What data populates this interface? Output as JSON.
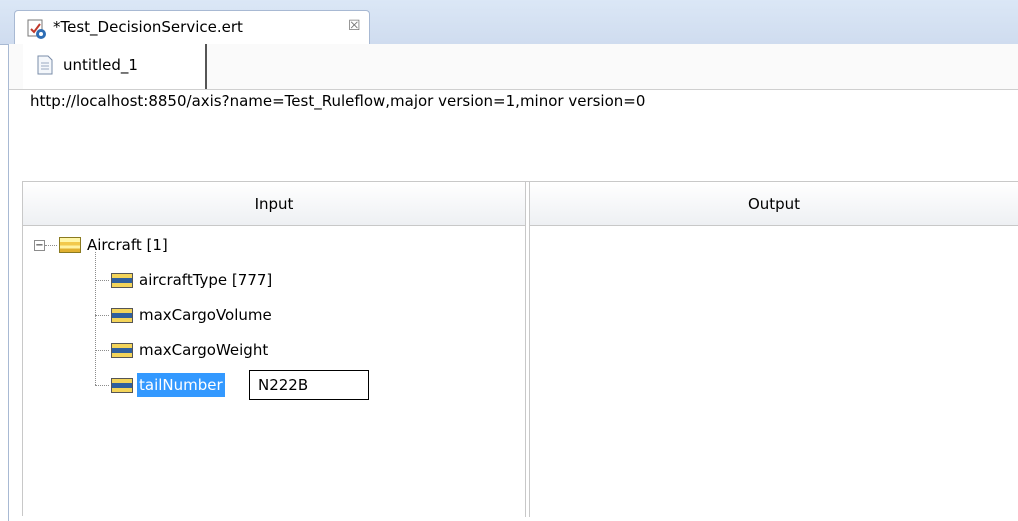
{
  "editor": {
    "tab_title": "*Test_DecisionService.ert",
    "close_glyph": "☒",
    "file_icon": "rule-test-file-icon"
  },
  "subtab": {
    "label": "untitled_1",
    "icon": "document-icon"
  },
  "service_url": "http://localhost:8850/axis?name=Test_Ruleflow,major version=1,minor version=0",
  "grid": {
    "input_header": "Input",
    "output_header": "Output"
  },
  "tree": {
    "root": {
      "label": "Aircraft [1]",
      "expanded": true,
      "icon": "entity-icon"
    },
    "children": [
      {
        "label": "aircraftType [777]",
        "icon": "attribute-icon"
      },
      {
        "label": "maxCargoVolume",
        "icon": "attribute-icon"
      },
      {
        "label": "maxCargoWeight",
        "icon": "attribute-icon"
      },
      {
        "label": "tailNumber",
        "icon": "attribute-icon",
        "selected": true,
        "edit_value": "N222B"
      }
    ]
  },
  "colors": {
    "selection": "#3399ff",
    "tab_bar": "#d6e3f5"
  }
}
